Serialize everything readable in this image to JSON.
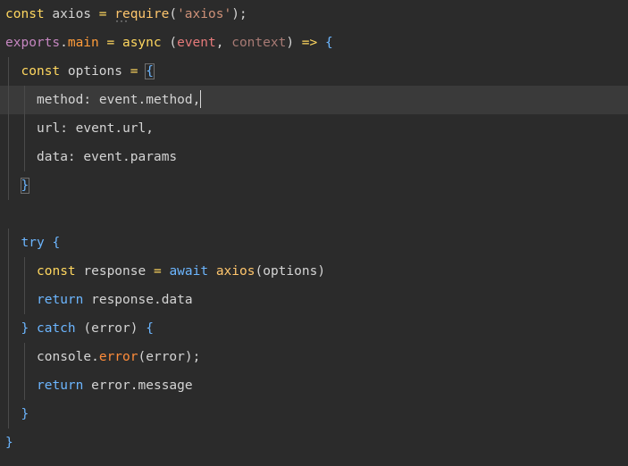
{
  "editor": {
    "lines": [
      [
        {
          "t": "const",
          "c": "tk-kw"
        },
        {
          "t": " axios ",
          "c": "tk-var"
        },
        {
          "t": "=",
          "c": "tk-op"
        },
        {
          "t": " ",
          "c": "tk-var"
        },
        {
          "t": "require",
          "c": "tk-fn"
        },
        {
          "t": "(",
          "c": "tk-pun"
        },
        {
          "t": "'axios'",
          "c": "tk-str"
        },
        {
          "t": ");",
          "c": "tk-pun"
        }
      ],
      [
        {
          "t": "exports",
          "c": "tk-exp"
        },
        {
          "t": ".",
          "c": "tk-pun"
        },
        {
          "t": "main",
          "c": "tk-main"
        },
        {
          "t": " ",
          "c": "tk-var"
        },
        {
          "t": "=",
          "c": "tk-op"
        },
        {
          "t": " ",
          "c": "tk-var"
        },
        {
          "t": "async",
          "c": "tk-kw"
        },
        {
          "t": " (",
          "c": "tk-pun"
        },
        {
          "t": "event",
          "c": "tk-par"
        },
        {
          "t": ", ",
          "c": "tk-pun"
        },
        {
          "t": "context",
          "c": "tk-par2"
        },
        {
          "t": ")",
          "c": "tk-pun"
        },
        {
          "t": " => ",
          "c": "tk-op"
        },
        {
          "t": "{",
          "c": "tk-brk"
        }
      ],
      [
        {
          "t": "const",
          "c": "tk-kw"
        },
        {
          "t": " options ",
          "c": "tk-var"
        },
        {
          "t": "=",
          "c": "tk-op"
        },
        {
          "t": " ",
          "c": "tk-var"
        },
        {
          "t": "{",
          "c": "tk-brk"
        }
      ],
      [
        {
          "t": "method",
          "c": "tk-var"
        },
        {
          "t": ": ",
          "c": "tk-pun"
        },
        {
          "t": "event",
          "c": "tk-var"
        },
        {
          "t": ".",
          "c": "tk-pun"
        },
        {
          "t": "method",
          "c": "tk-var"
        },
        {
          "t": ",",
          "c": "tk-pun"
        }
      ],
      [
        {
          "t": "url",
          "c": "tk-var"
        },
        {
          "t": ": ",
          "c": "tk-pun"
        },
        {
          "t": "event",
          "c": "tk-var"
        },
        {
          "t": ".",
          "c": "tk-pun"
        },
        {
          "t": "url",
          "c": "tk-var"
        },
        {
          "t": ",",
          "c": "tk-pun"
        }
      ],
      [
        {
          "t": "data",
          "c": "tk-var"
        },
        {
          "t": ": ",
          "c": "tk-pun"
        },
        {
          "t": "event",
          "c": "tk-var"
        },
        {
          "t": ".",
          "c": "tk-pun"
        },
        {
          "t": "params",
          "c": "tk-var"
        }
      ],
      [
        {
          "t": "}",
          "c": "tk-brk"
        }
      ],
      [],
      [
        {
          "t": "try",
          "c": "tk-ctl"
        },
        {
          "t": " ",
          "c": "tk-var"
        },
        {
          "t": "{",
          "c": "tk-brk"
        }
      ],
      [
        {
          "t": "const",
          "c": "tk-kw"
        },
        {
          "t": " response ",
          "c": "tk-var"
        },
        {
          "t": "=",
          "c": "tk-op"
        },
        {
          "t": " ",
          "c": "tk-var"
        },
        {
          "t": "await",
          "c": "tk-ctl"
        },
        {
          "t": " ",
          "c": "tk-var"
        },
        {
          "t": "axios",
          "c": "tk-fn"
        },
        {
          "t": "(",
          "c": "tk-pun"
        },
        {
          "t": "options",
          "c": "tk-var"
        },
        {
          "t": ")",
          "c": "tk-pun"
        }
      ],
      [
        {
          "t": "return",
          "c": "tk-ctl"
        },
        {
          "t": " response",
          "c": "tk-var"
        },
        {
          "t": ".",
          "c": "tk-pun"
        },
        {
          "t": "data",
          "c": "tk-var"
        }
      ],
      [
        {
          "t": "}",
          "c": "tk-brk"
        },
        {
          "t": " ",
          "c": "tk-var"
        },
        {
          "t": "catch",
          "c": "tk-ctl"
        },
        {
          "t": " (",
          "c": "tk-pun"
        },
        {
          "t": "error",
          "c": "tk-var"
        },
        {
          "t": ") ",
          "c": "tk-pun"
        },
        {
          "t": "{",
          "c": "tk-brk"
        }
      ],
      [
        {
          "t": "console",
          "c": "tk-var"
        },
        {
          "t": ".",
          "c": "tk-pun"
        },
        {
          "t": "error",
          "c": "tk-err"
        },
        {
          "t": "(",
          "c": "tk-pun"
        },
        {
          "t": "error",
          "c": "tk-var"
        },
        {
          "t": ");",
          "c": "tk-pun"
        }
      ],
      [
        {
          "t": "return",
          "c": "tk-ctl"
        },
        {
          "t": " error",
          "c": "tk-var"
        },
        {
          "t": ".",
          "c": "tk-pun"
        },
        {
          "t": "message",
          "c": "tk-var"
        }
      ],
      [
        {
          "t": "}",
          "c": "tk-brk"
        }
      ],
      [
        {
          "t": "}",
          "c": "tk-brk"
        }
      ]
    ],
    "indent_levels": [
      0,
      0,
      1,
      2,
      2,
      2,
      1,
      0,
      1,
      2,
      2,
      1,
      2,
      2,
      1,
      0
    ],
    "active_line": 4,
    "hint_marker": "···"
  }
}
